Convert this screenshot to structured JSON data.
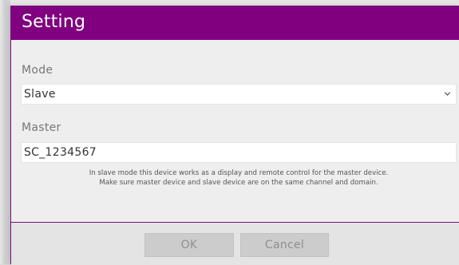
{
  "dialog": {
    "title": "Setting",
    "mode": {
      "label": "Mode",
      "selected": "Slave"
    },
    "master": {
      "label": "Master",
      "value": "SC_1234567"
    },
    "help_line1": "In slave mode this device works as a display and remote control for the master device.",
    "help_line2": "Make sure master device and slave device are on the same channel and domain.",
    "ok_label": "OK",
    "cancel_label": "Cancel"
  },
  "colors": {
    "titlebar": "#800080",
    "dialog_background": "#eeeeee",
    "button_disabled": "#cccccc"
  },
  "icons": {
    "mode_dropdown": "chevron-down-icon"
  }
}
